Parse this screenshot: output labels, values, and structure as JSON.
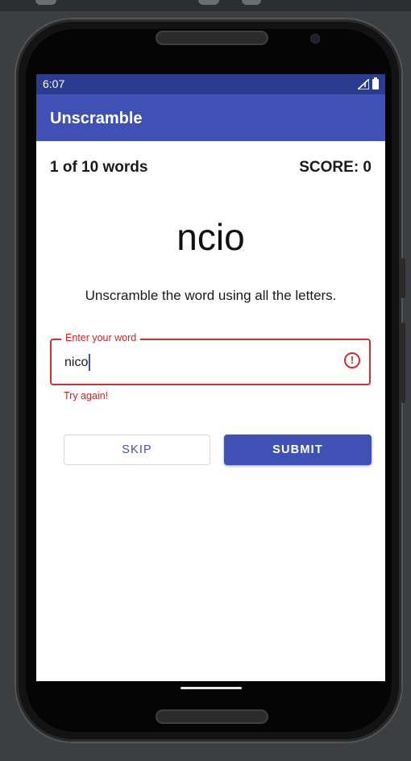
{
  "status_bar": {
    "time": "6:07",
    "icons": [
      "signal-icon",
      "battery-icon"
    ]
  },
  "app_bar": {
    "title": "Unscramble"
  },
  "game": {
    "word_count": "1 of 10 words",
    "score": "SCORE: 0",
    "scrambled_word": "ncio",
    "instructions": "Unscramble the word using all the letters."
  },
  "input": {
    "label": "Enter your word",
    "value": "nico",
    "error_text": "Try again!",
    "error_icon": "error-icon"
  },
  "buttons": {
    "skip": "SKIP",
    "submit": "SUBMIT"
  },
  "colors": {
    "primary": "#3f51b5",
    "primary_dark": "#2b3b8f",
    "error": "#d32f2f"
  }
}
